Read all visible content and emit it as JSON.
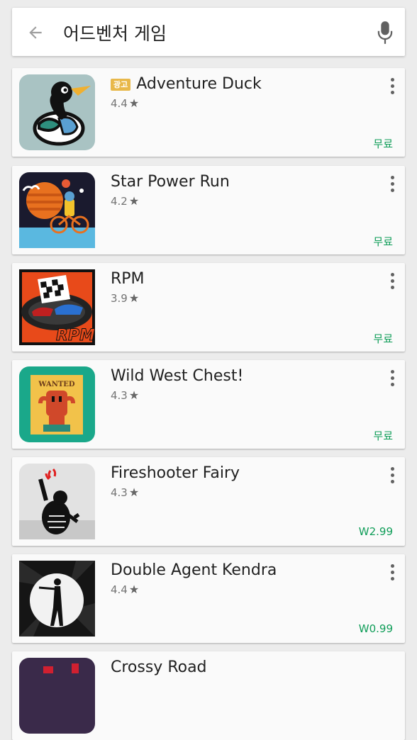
{
  "search": {
    "query": "어드벤처 게임"
  },
  "apps": [
    {
      "title": "Adventure Duck",
      "rating": "4.4",
      "price": "무료",
      "ad_label": "광고"
    },
    {
      "title": "Star Power Run",
      "rating": "4.2",
      "price": "무료"
    },
    {
      "title": "RPM",
      "rating": "3.9",
      "price": "무료"
    },
    {
      "title": "Wild West Chest!",
      "rating": "4.3",
      "price": "무료"
    },
    {
      "title": "Fireshooter Fairy",
      "rating": "4.3",
      "price": "W2.99"
    },
    {
      "title": "Double Agent Kendra",
      "rating": "4.4",
      "price": "W0.99"
    },
    {
      "title": "Crossy Road",
      "rating": "",
      "price": ""
    }
  ],
  "icons": {
    "back": "arrow-left-icon",
    "mic": "microphone-icon",
    "more": "more-vert-icon",
    "star": "star-icon"
  },
  "colors": {
    "price_green": "#0f9d58",
    "ad_badge": "#e8b84a"
  }
}
